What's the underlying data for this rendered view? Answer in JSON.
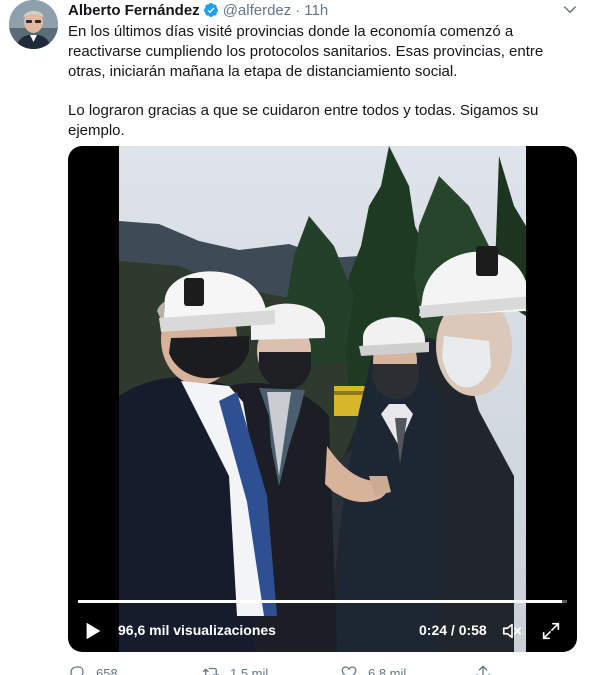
{
  "author": {
    "name": "Alberto Fernández",
    "handle": "@alferdez",
    "separator": "·",
    "time": "11h",
    "avatar_icon": "profile-avatar",
    "verified_icon": "verified-badge-icon",
    "verified_color": "#1da1f2"
  },
  "tweet": {
    "paragraph_1": "En los últimos días visité provincias donde la economía comenzó a reactivarse cumpliendo los protocolos sanitarios. Esas provincias, entre otras, iniciarán mañana la etapa de distanciamiento social.",
    "paragraph_2": "Lo lograron gracias a que se cuidaron entre todos y todas. Sigamos su ejemplo."
  },
  "video": {
    "views": "96,6 mil visualizaciones",
    "time": "0:24 / 0:58",
    "progress": 0.99,
    "play_icon": "play-icon",
    "mute_icon": "muted-speaker-icon",
    "fullscreen_icon": "fullscreen-icon"
  },
  "actions": {
    "replies": "658",
    "retweets": "1,5 mil",
    "likes": "6,8 mil",
    "reply_icon": "reply-icon",
    "retweet_icon": "retweet-icon",
    "like_icon": "heart-icon",
    "share_icon": "share-icon"
  },
  "colors": {
    "text": "#14171a",
    "secondary": "#657786",
    "accent": "#1da1f2"
  }
}
